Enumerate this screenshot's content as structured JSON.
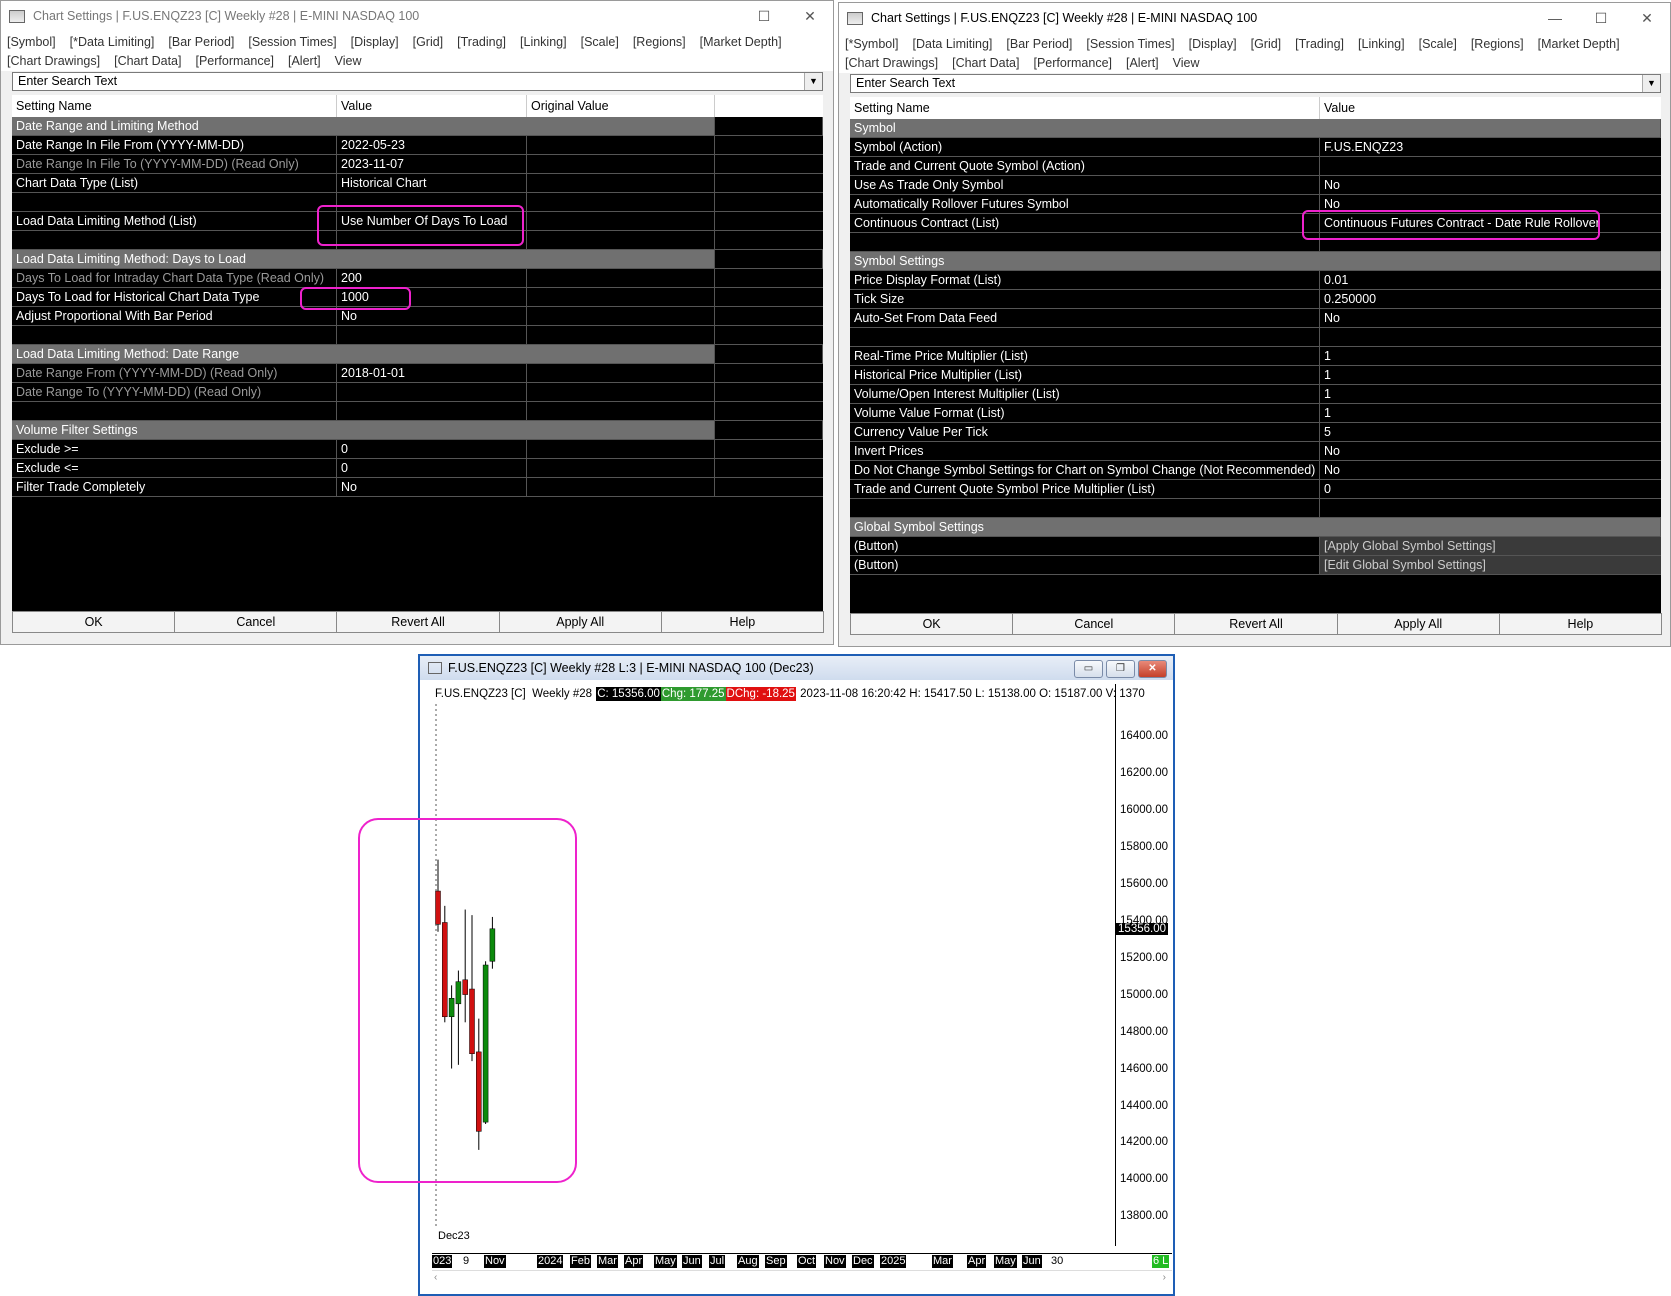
{
  "left_dialog": {
    "title": "Chart Settings | F.US.ENQZ23 [C]  Weekly #28 | E-MINI NASDAQ 100",
    "menu_row1": [
      "[Symbol]",
      "[*Data Limiting]",
      "[Bar Period]",
      "[Session Times]",
      "[Display]",
      "[Grid]",
      "[Trading]",
      "[Linking]",
      "[Scale]",
      "[Regions]",
      "[Market Depth]"
    ],
    "menu_row2": [
      "[Chart Drawings]",
      "[Chart Data]",
      "[Performance]",
      "[Alert]",
      "View"
    ],
    "search_placeholder": "Enter Search Text",
    "columns": [
      "Setting Name",
      "Value",
      "Original Value"
    ],
    "rows": [
      {
        "type": "sec",
        "name": "Date Range and Limiting Method"
      },
      {
        "type": "row",
        "name": "Date Range In File From (YYYY-MM-DD)",
        "value": "2022-05-23"
      },
      {
        "type": "ro",
        "name": "Date Range In File To (YYYY-MM-DD) (Read Only)",
        "value": "2023-11-07"
      },
      {
        "type": "row",
        "name": "Chart Data Type (List)",
        "value": "Historical Chart"
      },
      {
        "type": "blank",
        "name": "",
        "value": ""
      },
      {
        "type": "row",
        "name": "Load Data Limiting Method (List)",
        "value": "Use Number Of Days To Load"
      },
      {
        "type": "blank",
        "name": "",
        "value": ""
      },
      {
        "type": "sec",
        "name": "Load Data Limiting Method: Days to Load"
      },
      {
        "type": "ro",
        "name": "Days To Load for Intraday Chart Data Type (Read Only)",
        "value": "200"
      },
      {
        "type": "row",
        "name": "Days To Load for Historical Chart Data Type",
        "value": "1000"
      },
      {
        "type": "row",
        "name": "Adjust Proportional With Bar Period",
        "value": "No"
      },
      {
        "type": "blank",
        "name": "",
        "value": ""
      },
      {
        "type": "sec",
        "name": "Load Data Limiting Method: Date Range"
      },
      {
        "type": "ro",
        "name": "Date Range From (YYYY-MM-DD) (Read Only)",
        "value": "2018-01-01"
      },
      {
        "type": "ro",
        "name": "Date Range To (YYYY-MM-DD) (Read Only)",
        "value": ""
      },
      {
        "type": "blank",
        "name": "",
        "value": ""
      },
      {
        "type": "sec",
        "name": "Volume Filter Settings"
      },
      {
        "type": "row",
        "name": "Exclude >=",
        "value": "0"
      },
      {
        "type": "row",
        "name": "Exclude <=",
        "value": "0"
      },
      {
        "type": "row",
        "name": "Filter Trade Completely",
        "value": "No"
      }
    ],
    "buttons": [
      "OK",
      "Cancel",
      "Revert All",
      "Apply All",
      "Help"
    ]
  },
  "right_dialog": {
    "title": "Chart Settings | F.US.ENQZ23 [C]  Weekly #28 | E-MINI NASDAQ 100",
    "menu_row1": [
      "[*Symbol]",
      "[Data Limiting]",
      "[Bar Period]",
      "[Session Times]",
      "[Display]",
      "[Grid]",
      "[Trading]",
      "[Linking]",
      "[Scale]",
      "[Regions]",
      "[Market Depth]"
    ],
    "menu_row2": [
      "[Chart Drawings]",
      "[Chart Data]",
      "[Performance]",
      "[Alert]",
      "View"
    ],
    "search_placeholder": "Enter Search Text",
    "columns": [
      "Setting Name",
      "Value"
    ],
    "rows": [
      {
        "type": "sec",
        "name": "Symbol"
      },
      {
        "type": "row",
        "name": "Symbol (Action)",
        "value": "F.US.ENQZ23"
      },
      {
        "type": "row",
        "name": "Trade and Current Quote Symbol (Action)",
        "value": ""
      },
      {
        "type": "row",
        "name": "Use As Trade Only Symbol",
        "value": "No"
      },
      {
        "type": "row",
        "name": "Automatically Rollover Futures Symbol",
        "value": "No"
      },
      {
        "type": "row",
        "name": "Continuous Contract (List)",
        "value": "Continuous Futures Contract - Date Rule Rollover"
      },
      {
        "type": "blank",
        "name": "",
        "value": ""
      },
      {
        "type": "sec",
        "name": "Symbol Settings"
      },
      {
        "type": "row",
        "name": "Price Display Format (List)",
        "value": "0.01"
      },
      {
        "type": "row",
        "name": "Tick Size",
        "value": "0.250000"
      },
      {
        "type": "row",
        "name": "Auto-Set From Data Feed",
        "value": "No"
      },
      {
        "type": "blank",
        "name": "",
        "value": ""
      },
      {
        "type": "row",
        "name": "Real-Time Price Multiplier (List)",
        "value": "1"
      },
      {
        "type": "row",
        "name": "Historical Price Multiplier (List)",
        "value": "1"
      },
      {
        "type": "row",
        "name": "Volume/Open Interest Multiplier (List)",
        "value": "1"
      },
      {
        "type": "row",
        "name": "Volume Value Format (List)",
        "value": "1"
      },
      {
        "type": "row",
        "name": "Currency Value Per Tick",
        "value": "5"
      },
      {
        "type": "row",
        "name": "Invert Prices",
        "value": "No"
      },
      {
        "type": "row",
        "name": "Do Not Change Symbol Settings for Chart on Symbol Change (Not Recommended)",
        "value": "No"
      },
      {
        "type": "row",
        "name": "Trade and Current Quote Symbol Price Multiplier (List)",
        "value": "0"
      },
      {
        "type": "blank",
        "name": "",
        "value": ""
      },
      {
        "type": "sec",
        "name": "Global Symbol Settings"
      },
      {
        "type": "btn",
        "name": " (Button)",
        "value": "[Apply Global Symbol Settings]"
      },
      {
        "type": "btn",
        "name": " (Button)",
        "value": "[Edit Global Symbol Settings]"
      }
    ],
    "buttons": [
      "OK",
      "Cancel",
      "Revert All",
      "Apply All",
      "Help"
    ]
  },
  "chart_window": {
    "title": "F.US.ENQZ23 [C]  Weekly #28 L:3 | E-MINI NASDAQ 100 (Dec23)",
    "info": [
      {
        "text": "F.US.ENQZ23 [C]  Weekly #28 ",
        "bg": "",
        "fg": "#000"
      },
      {
        "text": "C: 15356.00",
        "bg": "#000",
        "fg": "#fff"
      },
      {
        "text": "Chg: 177.25",
        "bg": "#2f9a2f",
        "fg": "#fff"
      },
      {
        "text": "DChg: -18.25",
        "bg": "#e01010",
        "fg": "#fff"
      },
      {
        "text": " 2023-11-08 16:20:42 H: 15417.50 L: 15138.00 O: 15187.00 V: 1370",
        "bg": "",
        "fg": "#000"
      }
    ],
    "contract_label": "Dec23",
    "price_tag": "15356.00",
    "corner_badge": "6 L"
  },
  "chart_data": {
    "type": "candlestick",
    "y_ticks": [
      16400,
      16200,
      16000,
      15800,
      15600,
      15400,
      15200,
      15000,
      14800,
      14600,
      14400,
      14200,
      14000,
      13800
    ],
    "y_tick_labels": [
      "16400.00",
      "16200.00",
      "16000.00",
      "15800.00",
      "15600.00",
      "15400.00",
      "15200.00",
      "15000.00",
      "14800.00",
      "14600.00",
      "14400.00",
      "14200.00",
      "14000.00",
      "13800.00"
    ],
    "ylim": [
      13640,
      16680
    ],
    "last_price": 15356,
    "x_ticks": [
      "023",
      "9",
      "Nov",
      "2024",
      "Feb",
      "Mar",
      "Apr",
      "May",
      "Jun",
      "Jul",
      "Aug",
      "Sep",
      "Oct",
      "Nov",
      "Dec",
      "2025",
      "Mar",
      "Apr",
      "May",
      "Jun",
      "30"
    ],
    "bars": [
      {
        "o": 15560,
        "h": 15730,
        "l": 15340,
        "c": 15380
      },
      {
        "o": 15390,
        "h": 15480,
        "l": 14850,
        "c": 14880
      },
      {
        "o": 14880,
        "h": 15050,
        "l": 14600,
        "c": 14980
      },
      {
        "o": 14950,
        "h": 15130,
        "l": 14620,
        "c": 15070
      },
      {
        "o": 15080,
        "h": 15460,
        "l": 14850,
        "c": 15000
      },
      {
        "o": 15030,
        "h": 15430,
        "l": 14640,
        "c": 14680
      },
      {
        "o": 14690,
        "h": 14870,
        "l": 14160,
        "c": 14260
      },
      {
        "o": 14310,
        "h": 15180,
        "l": 14300,
        "c": 15160
      },
      {
        "o": 15180,
        "h": 15420,
        "l": 15140,
        "c": 15356
      }
    ]
  }
}
